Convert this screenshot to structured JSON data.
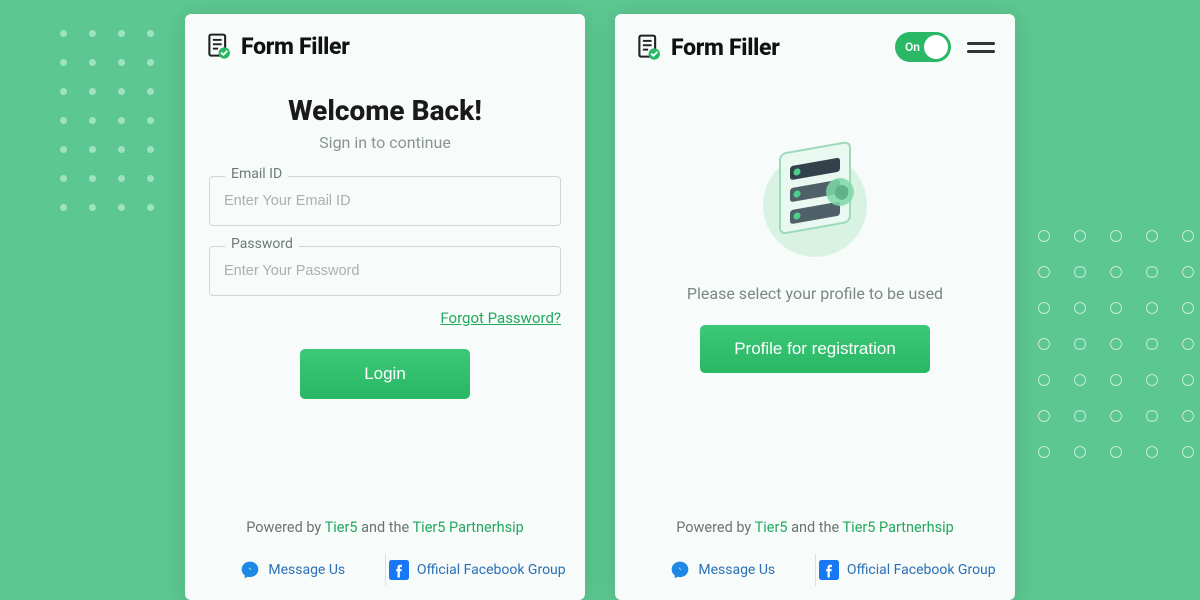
{
  "app": {
    "title": "Form Filler"
  },
  "login": {
    "welcome_title": "Welcome Back!",
    "welcome_sub": "Sign in to continue",
    "email_label": "Email ID",
    "email_placeholder": "Enter Your Email ID",
    "password_label": "Password",
    "password_placeholder": "Enter Your Password",
    "forgot_label": "Forgot Password?",
    "login_button": "Login"
  },
  "profile": {
    "toggle_label": "On",
    "prompt": "Please select your profile to be used",
    "button": "Profile for registration"
  },
  "footer": {
    "powered_prefix": "Powered by ",
    "tier5": "Tier5",
    "and_the": " and the ",
    "partnership": "Tier5 Partnerhsip",
    "message_us": "Message Us",
    "facebook_group": "Official Facebook Group"
  }
}
